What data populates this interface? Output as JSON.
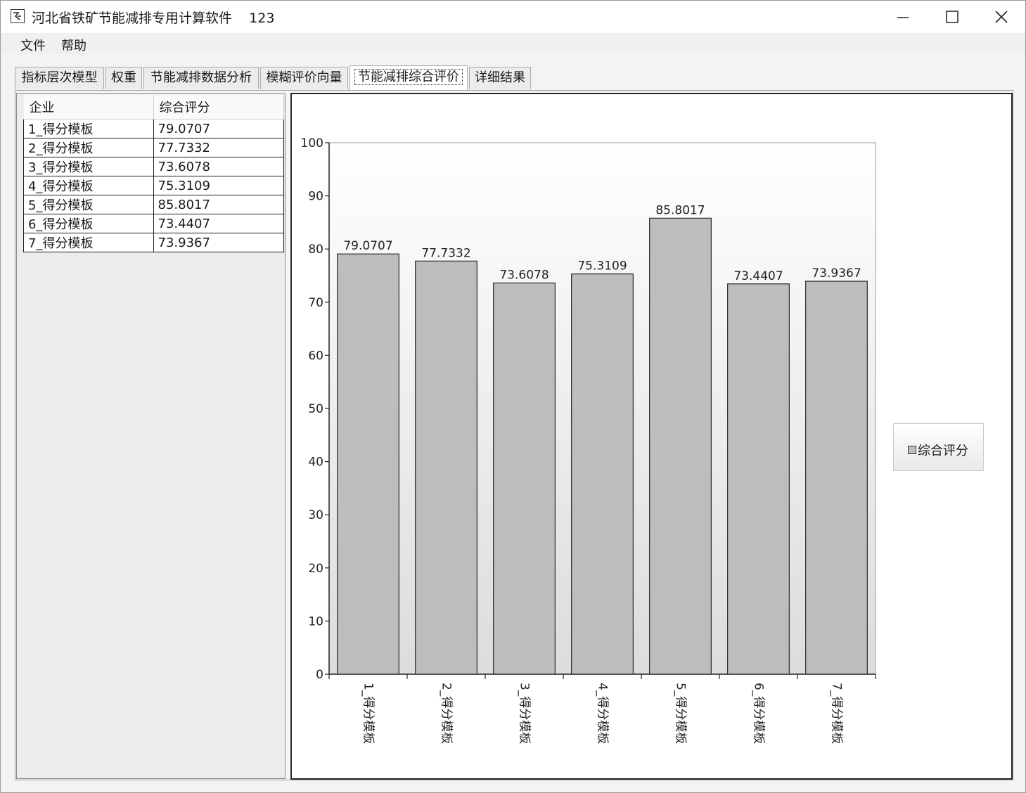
{
  "window": {
    "title": "河北省铁矿节能减排专用计算软件    123"
  },
  "menu": [
    "文件",
    "帮助"
  ],
  "tabs": [
    {
      "label": "指标层次模型"
    },
    {
      "label": "权重"
    },
    {
      "label": "节能减排数据分析"
    },
    {
      "label": "模糊评价向量"
    },
    {
      "label": "节能减排综合评价"
    },
    {
      "label": "详细结果"
    }
  ],
  "active_tab": "节能减排综合评价",
  "grid": {
    "headers": [
      "企业",
      "综合评分"
    ],
    "rows": [
      [
        "1_得分模板",
        "79.0707"
      ],
      [
        "2_得分模板",
        "77.7332"
      ],
      [
        "3_得分模板",
        "73.6078"
      ],
      [
        "4_得分模板",
        "75.3109"
      ],
      [
        "5_得分模板",
        "85.8017"
      ],
      [
        "6_得分模板",
        "73.4407"
      ],
      [
        "7_得分模板",
        "73.9367"
      ]
    ]
  },
  "chart_data": {
    "type": "bar",
    "categories": [
      "1_得分模板",
      "2_得分模板",
      "3_得分模板",
      "4_得分模板",
      "5_得分模板",
      "6_得分模板",
      "7_得分模板"
    ],
    "series": [
      {
        "name": "综合评分",
        "values": [
          79.0707,
          77.7332,
          73.6078,
          75.3109,
          85.8017,
          73.4407,
          73.9367
        ]
      }
    ],
    "data_labels": [
      "79.0707",
      "77.7332",
      "73.6078",
      "75.3109",
      "85.8017",
      "73.4407",
      "73.9367"
    ],
    "ylim": [
      0,
      100
    ],
    "yticks": [
      0,
      10,
      20,
      30,
      40,
      50,
      60,
      70,
      80,
      90,
      100
    ],
    "legend_position": "right",
    "bar_color": "#bdbdbd",
    "grid": false
  }
}
